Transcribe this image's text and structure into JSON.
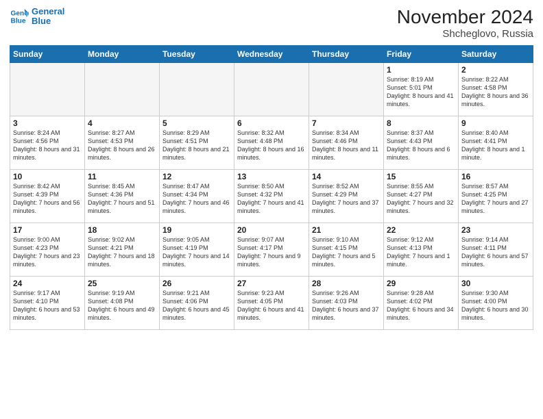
{
  "logo": {
    "line1": "General",
    "line2": "Blue"
  },
  "title": "November 2024",
  "location": "Shcheglovo, Russia",
  "days_header": [
    "Sunday",
    "Monday",
    "Tuesday",
    "Wednesday",
    "Thursday",
    "Friday",
    "Saturday"
  ],
  "weeks": [
    [
      {
        "day": "",
        "info": ""
      },
      {
        "day": "",
        "info": ""
      },
      {
        "day": "",
        "info": ""
      },
      {
        "day": "",
        "info": ""
      },
      {
        "day": "",
        "info": ""
      },
      {
        "day": "1",
        "info": "Sunrise: 8:19 AM\nSunset: 5:01 PM\nDaylight: 8 hours and 41 minutes."
      },
      {
        "day": "2",
        "info": "Sunrise: 8:22 AM\nSunset: 4:58 PM\nDaylight: 8 hours and 36 minutes."
      }
    ],
    [
      {
        "day": "3",
        "info": "Sunrise: 8:24 AM\nSunset: 4:56 PM\nDaylight: 8 hours and 31 minutes."
      },
      {
        "day": "4",
        "info": "Sunrise: 8:27 AM\nSunset: 4:53 PM\nDaylight: 8 hours and 26 minutes."
      },
      {
        "day": "5",
        "info": "Sunrise: 8:29 AM\nSunset: 4:51 PM\nDaylight: 8 hours and 21 minutes."
      },
      {
        "day": "6",
        "info": "Sunrise: 8:32 AM\nSunset: 4:48 PM\nDaylight: 8 hours and 16 minutes."
      },
      {
        "day": "7",
        "info": "Sunrise: 8:34 AM\nSunset: 4:46 PM\nDaylight: 8 hours and 11 minutes."
      },
      {
        "day": "8",
        "info": "Sunrise: 8:37 AM\nSunset: 4:43 PM\nDaylight: 8 hours and 6 minutes."
      },
      {
        "day": "9",
        "info": "Sunrise: 8:40 AM\nSunset: 4:41 PM\nDaylight: 8 hours and 1 minute."
      }
    ],
    [
      {
        "day": "10",
        "info": "Sunrise: 8:42 AM\nSunset: 4:39 PM\nDaylight: 7 hours and 56 minutes."
      },
      {
        "day": "11",
        "info": "Sunrise: 8:45 AM\nSunset: 4:36 PM\nDaylight: 7 hours and 51 minutes."
      },
      {
        "day": "12",
        "info": "Sunrise: 8:47 AM\nSunset: 4:34 PM\nDaylight: 7 hours and 46 minutes."
      },
      {
        "day": "13",
        "info": "Sunrise: 8:50 AM\nSunset: 4:32 PM\nDaylight: 7 hours and 41 minutes."
      },
      {
        "day": "14",
        "info": "Sunrise: 8:52 AM\nSunset: 4:29 PM\nDaylight: 7 hours and 37 minutes."
      },
      {
        "day": "15",
        "info": "Sunrise: 8:55 AM\nSunset: 4:27 PM\nDaylight: 7 hours and 32 minutes."
      },
      {
        "day": "16",
        "info": "Sunrise: 8:57 AM\nSunset: 4:25 PM\nDaylight: 7 hours and 27 minutes."
      }
    ],
    [
      {
        "day": "17",
        "info": "Sunrise: 9:00 AM\nSunset: 4:23 PM\nDaylight: 7 hours and 23 minutes."
      },
      {
        "day": "18",
        "info": "Sunrise: 9:02 AM\nSunset: 4:21 PM\nDaylight: 7 hours and 18 minutes."
      },
      {
        "day": "19",
        "info": "Sunrise: 9:05 AM\nSunset: 4:19 PM\nDaylight: 7 hours and 14 minutes."
      },
      {
        "day": "20",
        "info": "Sunrise: 9:07 AM\nSunset: 4:17 PM\nDaylight: 7 hours and 9 minutes."
      },
      {
        "day": "21",
        "info": "Sunrise: 9:10 AM\nSunset: 4:15 PM\nDaylight: 7 hours and 5 minutes."
      },
      {
        "day": "22",
        "info": "Sunrise: 9:12 AM\nSunset: 4:13 PM\nDaylight: 7 hours and 1 minute."
      },
      {
        "day": "23",
        "info": "Sunrise: 9:14 AM\nSunset: 4:11 PM\nDaylight: 6 hours and 57 minutes."
      }
    ],
    [
      {
        "day": "24",
        "info": "Sunrise: 9:17 AM\nSunset: 4:10 PM\nDaylight: 6 hours and 53 minutes."
      },
      {
        "day": "25",
        "info": "Sunrise: 9:19 AM\nSunset: 4:08 PM\nDaylight: 6 hours and 49 minutes."
      },
      {
        "day": "26",
        "info": "Sunrise: 9:21 AM\nSunset: 4:06 PM\nDaylight: 6 hours and 45 minutes."
      },
      {
        "day": "27",
        "info": "Sunrise: 9:23 AM\nSunset: 4:05 PM\nDaylight: 6 hours and 41 minutes."
      },
      {
        "day": "28",
        "info": "Sunrise: 9:26 AM\nSunset: 4:03 PM\nDaylight: 6 hours and 37 minutes."
      },
      {
        "day": "29",
        "info": "Sunrise: 9:28 AM\nSunset: 4:02 PM\nDaylight: 6 hours and 34 minutes."
      },
      {
        "day": "30",
        "info": "Sunrise: 9:30 AM\nSunset: 4:00 PM\nDaylight: 6 hours and 30 minutes."
      }
    ]
  ]
}
